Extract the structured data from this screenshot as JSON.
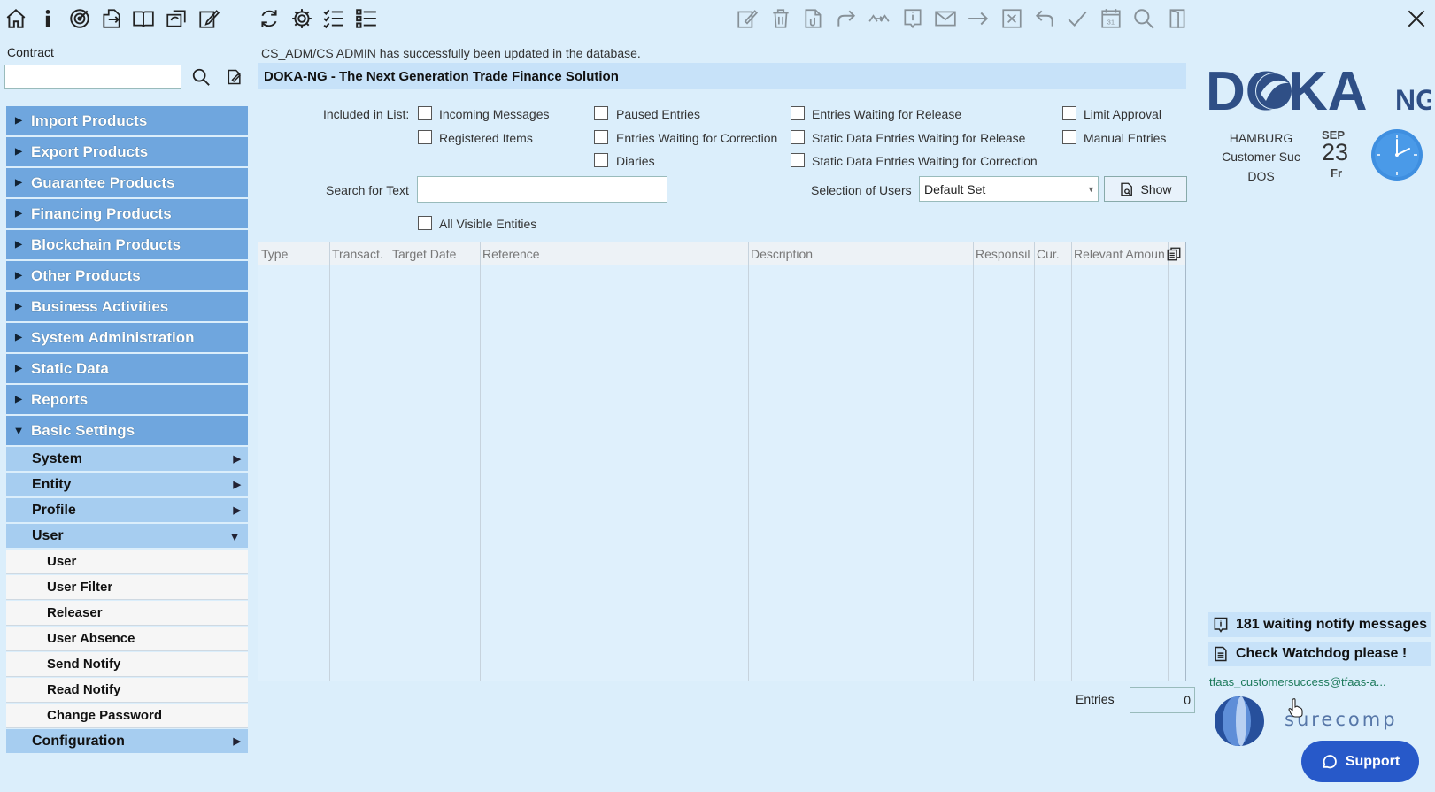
{
  "toolbar": {
    "left_icons": [
      "home-icon",
      "info-icon",
      "target-icon",
      "export-icon",
      "book-icon",
      "refresh-group-icon",
      "edit-icon",
      "refresh-icon",
      "gear-icon",
      "checklist-icon",
      "list-icon"
    ],
    "right_icons": [
      "edit-doc-icon",
      "trash-icon",
      "attach-doc-icon",
      "forward-icon",
      "swap-icon",
      "info-frame-icon",
      "mail-icon",
      "arrow-right-icon",
      "cancel-icon",
      "undo-icon",
      "check-icon",
      "calendar-icon",
      "search-icon",
      "door-icon"
    ],
    "close_icon": "close-icon"
  },
  "sidebar": {
    "contract_label": "Contract",
    "contract_value": "",
    "nav": [
      {
        "label": "Import Products",
        "expanded": false
      },
      {
        "label": "Export Products",
        "expanded": false
      },
      {
        "label": "Guarantee Products",
        "expanded": false
      },
      {
        "label": "Financing Products",
        "expanded": false
      },
      {
        "label": "Blockchain Products",
        "expanded": false
      },
      {
        "label": "Other Products",
        "expanded": false
      },
      {
        "label": "Business Activities",
        "expanded": false
      },
      {
        "label": "System Administration",
        "expanded": false
      },
      {
        "label": "Static Data",
        "expanded": false
      },
      {
        "label": "Reports",
        "expanded": false
      },
      {
        "label": "Basic Settings",
        "expanded": true
      }
    ],
    "basic_settings_sub": [
      {
        "label": "System",
        "arrow": "▶"
      },
      {
        "label": "Entity",
        "arrow": "▶"
      },
      {
        "label": "Profile",
        "arrow": "▶"
      },
      {
        "label": "User",
        "arrow": "▼"
      }
    ],
    "user_items": [
      "User",
      "User Filter",
      "Releaser",
      "User Absence",
      "Send Notify",
      "Read Notify",
      "Change Password"
    ],
    "configuration": {
      "label": "Configuration",
      "arrow": "▶"
    }
  },
  "main": {
    "status_message": "CS_ADM/CS ADMIN has successfully been updated in the database.",
    "title": "DOKA-NG - The Next Generation Trade Finance Solution",
    "included_label": "Included in List:",
    "checkboxes": {
      "incoming_messages": "Incoming Messages",
      "registered_items": "Registered Items",
      "paused_entries": "Paused Entries",
      "entries_waiting_correction": "Entries Waiting for Correction",
      "diaries": "Diaries",
      "entries_waiting_release": "Entries Waiting for Release",
      "static_waiting_release": "Static Data Entries Waiting for Release",
      "static_waiting_correction": "Static Data Entries Waiting for Correction",
      "limit_approval": "Limit Approval",
      "manual_entries": "Manual Entries",
      "all_visible_entities": "All Visible Entities"
    },
    "search_label": "Search for Text",
    "search_value": "",
    "selection_label": "Selection of Users",
    "selection_value": "Default Set",
    "show_label": "Show",
    "columns": [
      "Type",
      "Transact.",
      "Target Date",
      "Reference",
      "Description",
      "Responsil",
      "Cur.",
      "Relevant Amoun"
    ],
    "entries_label": "Entries",
    "entries_value": "0"
  },
  "right_panel": {
    "logo_main": "DOKA",
    "logo_suffix": "NG",
    "location": "HAMBURG",
    "customer": "Customer Suc",
    "dos": "DOS",
    "date_month": "SEP",
    "date_day": "23",
    "date_weekday": "Fr",
    "notify_messages": "181 waiting notify messages",
    "watchdog": "Check Watchdog please !",
    "email": "tfaas_customersuccess@tfaas-a...",
    "company": "surecomp",
    "support_label": "Support"
  },
  "colors": {
    "background": "#dbeefb",
    "nav_item": "#6fa6de",
    "sub_item": "#a6cdf0",
    "title_bar": "#c7e2f9",
    "support": "#2759c9",
    "logo": "#2f4f86"
  }
}
